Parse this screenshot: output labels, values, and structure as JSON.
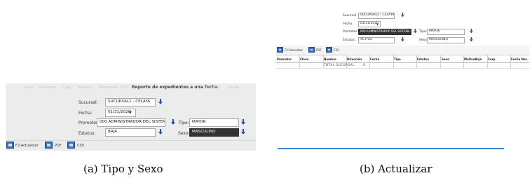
{
  "panel_a": {
    "menu_faint": [
      "Inicio",
      "Promotor",
      "Caja",
      "Tesorería",
      "Préstamos",
      "Cob"
    ],
    "menu_faint_right": [
      "Usuarios",
      "Ayuda"
    ],
    "title": "Reporte de expedientes a una fecha",
    "form": {
      "sucursal_label": "Sucursal:",
      "sucursal_value": "SUCURSAL1 - CELAYA",
      "fecha_label": "Fecha:",
      "fecha_value": "01/31/2020",
      "promotor_label": "Promotor:",
      "promotor_value": "000 ADMINISTRADOR DEL SISTEMA",
      "tipo_label": "Tipo:",
      "tipo_value": "MAYOR",
      "estatus_label": "Estatus:",
      "estatus_value": "BAJA",
      "sexo_label": "Sexo:",
      "sexo_value": "MASCULINO"
    },
    "toolbar": {
      "actualizar_label": "F2-Actualizar",
      "pdf_label": "PDF",
      "csv_label": "CSV"
    }
  },
  "panel_b": {
    "form": {
      "sucursal_label": "Sucursal:",
      "sucursal_value": "SUCURSAL1 - CELAYA",
      "fecha_label": "Fecha:",
      "fecha_value": "01/31/2020",
      "promotor_label": "Promotor:",
      "promotor_value": "000 ADMINISTRADOR DEL SISTEMA",
      "tipo_label": "Tipo:",
      "tipo_value": "MAYOR",
      "estatus_label": "Estatus:",
      "estatus_value": "ACTIVO",
      "sexo_label": "Sexo:",
      "sexo_value": "MASCULINO"
    },
    "toolbar": {
      "actualizar_label": "F2-Actualizar",
      "pdf_label": "PDF",
      "csv_label": "CSV"
    },
    "table": {
      "headers": [
        "Promotor",
        "Clave",
        "Nombre",
        "Dirección",
        "Fecha",
        "Tipo",
        "Estatus",
        "Sexo",
        "MotivoBaja",
        "Curp",
        "Fecha Nac."
      ],
      "total_label": "TOTAL SUCURSAL",
      "total_value": "0"
    }
  },
  "captions": {
    "a": "(a) Tipo y Sexo",
    "b": "(b) Actualizar"
  }
}
